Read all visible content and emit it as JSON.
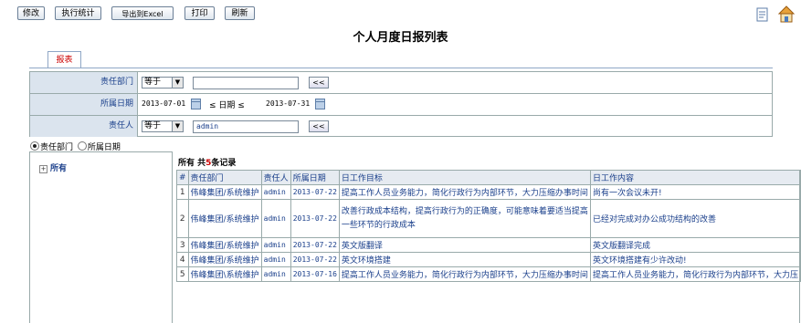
{
  "toolbar": {
    "edit": "修改",
    "stats": "执行统计",
    "export": "导出到Excel",
    "print": "打印",
    "refresh": "刷新"
  },
  "page": {
    "title": "个人月度日报列表",
    "tab": "报表"
  },
  "icons": {
    "top_right": [
      "document-list-icon",
      "home-icon"
    ]
  },
  "filters": {
    "dept": {
      "label": "责任部门",
      "op": "等于",
      "value": "",
      "btn": "<<"
    },
    "date": {
      "label": "所属日期",
      "from": "2013-07-01",
      "mid": "≤ 日期 ≤",
      "to": "2013-07-31"
    },
    "owner": {
      "label": "责任人",
      "op": "等于",
      "value": "admin",
      "btn": "<<"
    }
  },
  "group_by": {
    "options": [
      "责任部门",
      "所属日期"
    ],
    "selected": "责任部门"
  },
  "tree": {
    "root": "所有"
  },
  "summary": {
    "prefix": "所有  共",
    "count": "5",
    "suffix": "条记录"
  },
  "table": {
    "headers": [
      "#",
      "责任部门",
      "责任人",
      "所属日期",
      "日工作目标",
      "日工作内容"
    ],
    "rows": [
      {
        "no": "1",
        "dept": "伟峰集团/系统维护",
        "owner": "admin",
        "date": "2013-07-22",
        "goal": "提高工作人员业务能力，简化行政行为内部环节，大力压缩办事时间",
        "content": "尚有一次会议未开!"
      },
      {
        "no": "2",
        "dept": "伟峰集团/系统维护",
        "owner": "admin",
        "date": "2013-07-22",
        "goal": "改善行政成本结构，提高行政行为的正确度，可能意味着要适当提高一些环节的行政成本",
        "content": "已经对完成对办公成功结构的改善"
      },
      {
        "no": "3",
        "dept": "伟峰集团/系统维护",
        "owner": "admin",
        "date": "2013-07-22",
        "goal": "英文版翻译",
        "content": "英文版翻译完成"
      },
      {
        "no": "4",
        "dept": "伟峰集团/系统维护",
        "owner": "admin",
        "date": "2013-07-22",
        "goal": "英文环境搭建",
        "content": "英文环境搭建有少许改动!"
      },
      {
        "no": "5",
        "dept": "伟峰集团\\系统维护",
        "owner": "admin",
        "date": "2013-07-16",
        "goal": "提高工作人员业务能力，简化行政行为内部环节，大力压缩办事时间",
        "content": "提高工作人员业务能力，简化行政行为内部环节，大力压"
      }
    ]
  }
}
